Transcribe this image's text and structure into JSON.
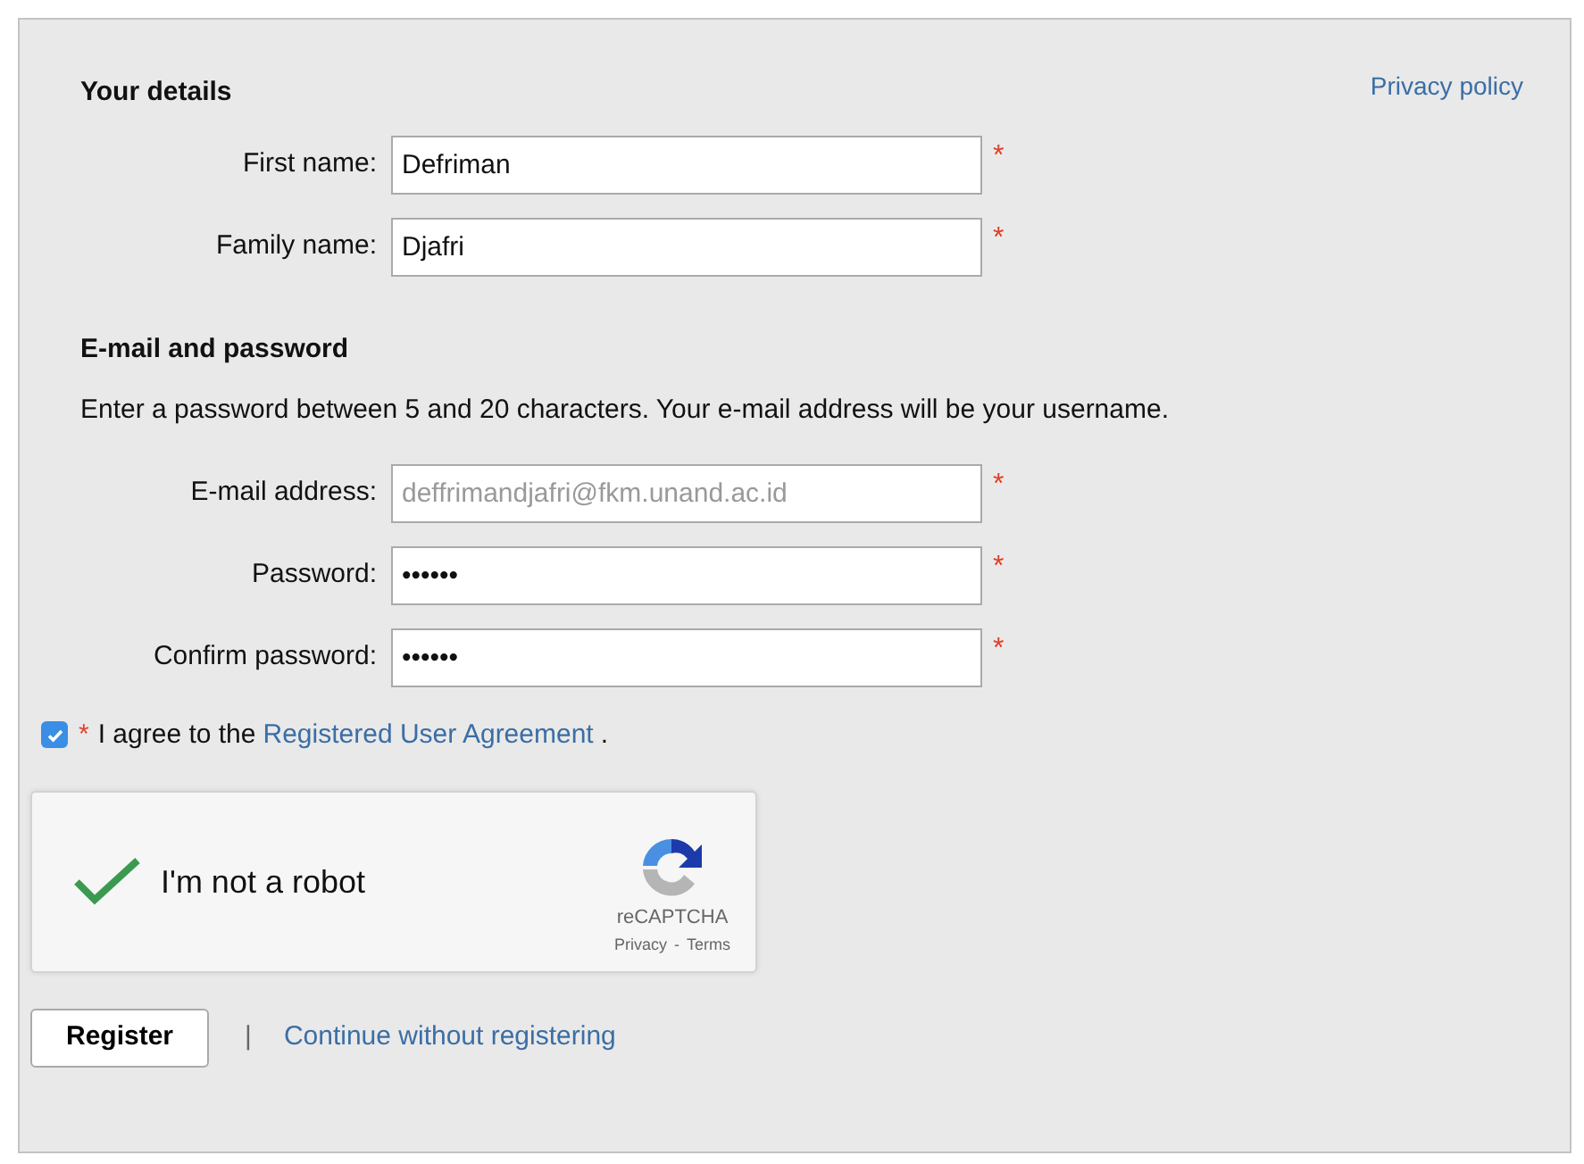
{
  "privacy_link": "Privacy policy",
  "sections": [
    {
      "heading": "Your details",
      "fields": [
        {
          "label": "First name:",
          "value": "Defriman",
          "required": true,
          "disabled": false
        },
        {
          "label": "Family name:",
          "value": "Djafri",
          "required": true,
          "disabled": false
        }
      ]
    },
    {
      "heading": "E-mail and password",
      "note": "Enter a password between 5 and 20 characters. Your e-mail address will be your username.",
      "fields": [
        {
          "label": "E-mail address:",
          "value": "deffrimandjafri@fkm.unand.ac.id",
          "required": true,
          "disabled": true
        },
        {
          "label": "Password:",
          "value": "••••••",
          "required": true,
          "disabled": false
        },
        {
          "label": "Confirm password:",
          "value": "••••••",
          "required": true,
          "disabled": false
        }
      ]
    }
  ],
  "agreement": {
    "checked": true,
    "required_mark": "*",
    "text": "I agree to the",
    "link": "Registered User Agreement",
    "end": "."
  },
  "captcha": {
    "checked": true,
    "label": "I'm not a robot",
    "brand": "reCAPTCHA",
    "privacy": "Privacy",
    "separator": "-",
    "terms": "Terms"
  },
  "register_button": "Register",
  "separator": "|",
  "continue_link": "Continue without registering"
}
